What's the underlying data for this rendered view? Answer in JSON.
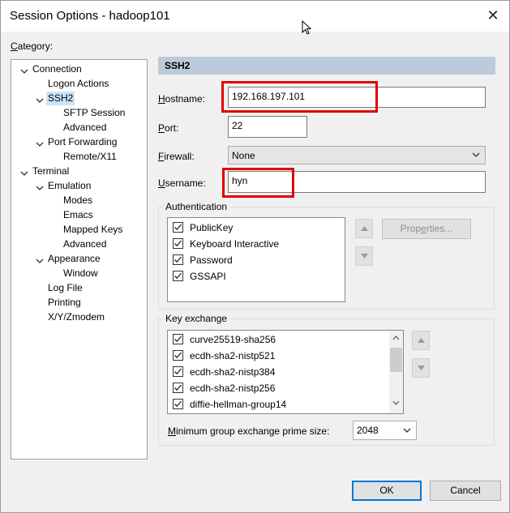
{
  "window": {
    "title": "Session Options - hadoop101"
  },
  "category": {
    "label_prefix": "C",
    "label_rest": "ategory:",
    "tree": [
      {
        "label": "Connection"
      },
      {
        "label": "Logon Actions"
      },
      {
        "label": "SSH2",
        "selected": true
      },
      {
        "label": "SFTP Session"
      },
      {
        "label": "Advanced"
      },
      {
        "label": "Port Forwarding"
      },
      {
        "label": "Remote/X11"
      },
      {
        "label": "Terminal"
      },
      {
        "label": "Emulation"
      },
      {
        "label": "Modes"
      },
      {
        "label": "Emacs"
      },
      {
        "label": "Mapped Keys"
      },
      {
        "label": "Advanced"
      },
      {
        "label": "Appearance"
      },
      {
        "label": "Window"
      },
      {
        "label": "Log File"
      },
      {
        "label": "Printing"
      },
      {
        "label": "X/Y/Zmodem"
      }
    ]
  },
  "panel": {
    "header": "SSH2",
    "hostname": {
      "mnemonic": "H",
      "rest": "ostname:",
      "value": "192.168.197.101"
    },
    "port": {
      "mnemonic": "P",
      "rest": "ort:",
      "value": "22"
    },
    "firewall": {
      "mnemonic": "F",
      "rest": "irewall:",
      "value": "None"
    },
    "username": {
      "mnemonic": "U",
      "rest": "sername:",
      "value": "hyn"
    },
    "authentication": {
      "title": "Authentication",
      "items": [
        {
          "label": "PublicKey",
          "checked": true
        },
        {
          "label": "Keyboard Interactive",
          "checked": true
        },
        {
          "label": "Password",
          "checked": true
        },
        {
          "label": "GSSAPI",
          "checked": true
        }
      ],
      "properties_pre": "Prop",
      "properties_mnemonic": "e",
      "properties_post": "rties..."
    },
    "key_exchange": {
      "title": "Key exchange",
      "items": [
        {
          "label": "curve25519-sha256",
          "checked": true
        },
        {
          "label": "ecdh-sha2-nistp521",
          "checked": true
        },
        {
          "label": "ecdh-sha2-nistp384",
          "checked": true
        },
        {
          "label": "ecdh-sha2-nistp256",
          "checked": true
        },
        {
          "label": "diffie-hellman-group14",
          "checked": true
        }
      ],
      "min_prime_mnemonic": "M",
      "min_prime_rest": "inimum group exchange prime size:",
      "min_prime_value": "2048"
    }
  },
  "buttons": {
    "ok": "OK",
    "cancel": "Cancel"
  },
  "colors": {
    "highlight_box": "#e00000",
    "header_band": "#bccbd9",
    "default_button_border": "#0078d7",
    "selection": "#cce4f7"
  }
}
